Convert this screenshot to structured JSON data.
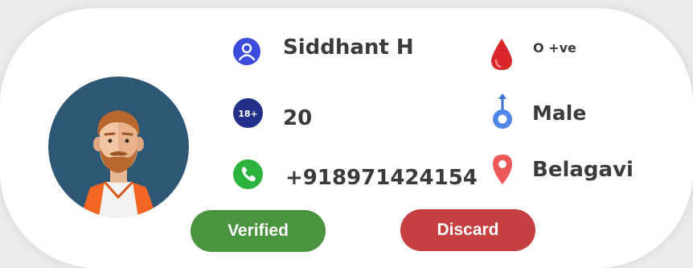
{
  "profile": {
    "name": "Siddhant H",
    "age": "20",
    "phone": "+918971424154",
    "blood_group": "O +ve",
    "gender": "Male",
    "location": "Belagavi"
  },
  "icons": {
    "person": "person-icon",
    "age_badge": "18+",
    "phone": "phone-icon",
    "blood": "blood-drop-icon",
    "gender": "male-icon",
    "location": "location-pin-icon"
  },
  "actions": {
    "verified_label": "Verified",
    "discard_label": "Discard"
  },
  "colors": {
    "verified": "#4a9440",
    "discard": "#c54041",
    "avatar_bg": "#2d5775",
    "person_icon": "#3b4bdb",
    "age_badge": "#23308a",
    "phone_icon": "#2bb33e",
    "blood_icon": "#d8262b",
    "gender_icon": "#4f86e8",
    "location_icon": "#ee5757"
  }
}
